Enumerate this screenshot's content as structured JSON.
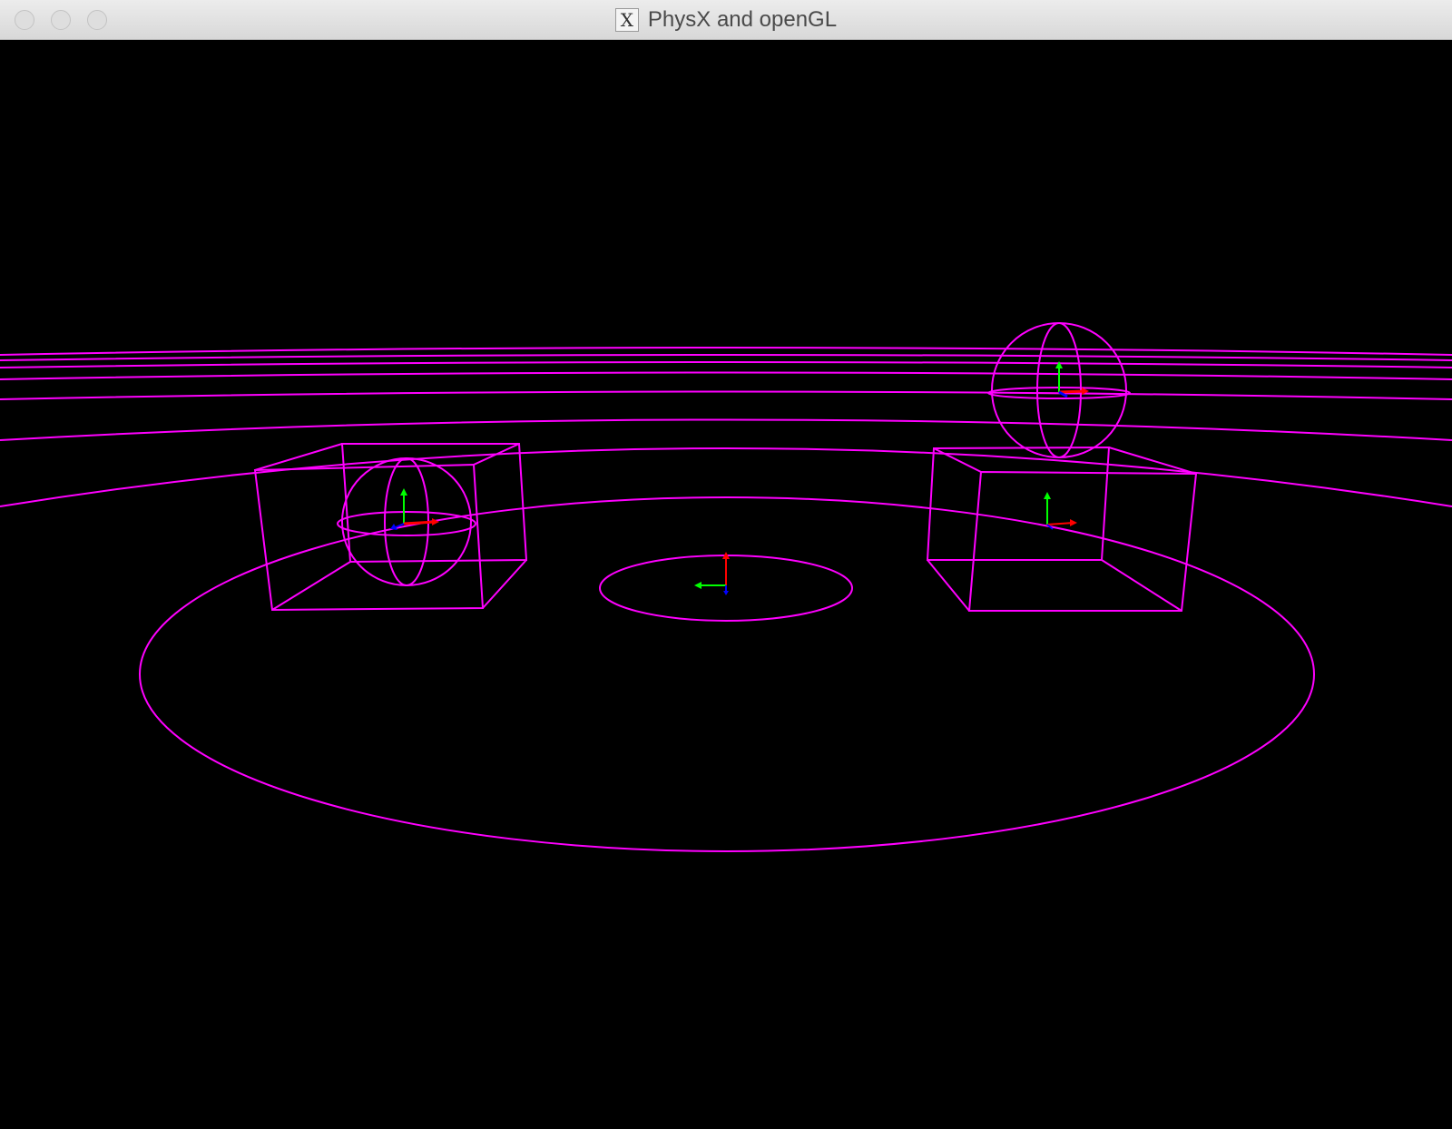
{
  "window": {
    "title": "PhysX and openGL",
    "icon": "x11-icon",
    "icon_glyph": "X"
  },
  "scene": {
    "background_color": "#000000",
    "wireframe_color": "#ff00ff",
    "axis_colors": {
      "x": "#ff0000",
      "y": "#00ff00",
      "z": "#0000ff"
    }
  }
}
